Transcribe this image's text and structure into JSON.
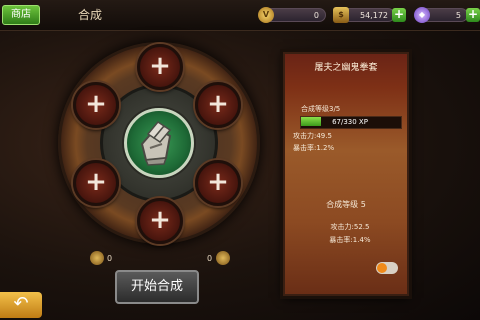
{
  "topbar": {
    "shop_label": "商店",
    "title": "合成",
    "vip_icon": "vip-coin-icon",
    "vip_value": "0",
    "gold_icon": "gold-pile-icon",
    "gold_value": "54,172",
    "gem_icon": "gem-icon",
    "gem_value": "5"
  },
  "craft": {
    "center_icon": "gauntlet-icon",
    "slots": [
      "+",
      "+",
      "+",
      "+",
      "+",
      "+"
    ],
    "material_left_count": "0",
    "material_right_count": "0",
    "start_label": "开始合成",
    "back_icon": "back-arrow-icon"
  },
  "panel": {
    "title": "屠夫之幽鬼拳套",
    "level_label": "合成等级3/5",
    "xp_text": "67/330 XP",
    "xp_fraction": 0.2,
    "attack": "攻击力:49.5",
    "crit": "暴击率:1.2%",
    "next_level": "合成等级 5",
    "next_attack": "攻击力:52.5",
    "next_crit": "暴击率:1.4%",
    "toggle_on": true
  },
  "colors": {
    "accent_green": "#4fb82c",
    "panel_red": "#7e3016",
    "slot_red": "#7a2a1a"
  }
}
